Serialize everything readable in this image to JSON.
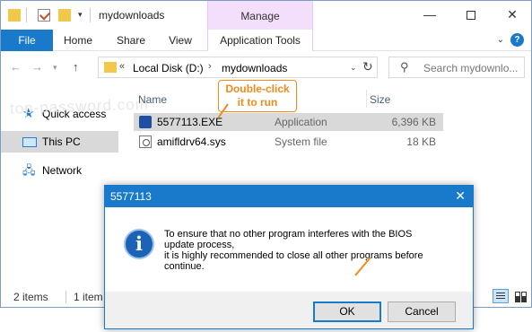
{
  "window": {
    "title": "mydownloads",
    "context_tab": "Manage",
    "controls": {
      "minimize": "—",
      "close": "✕"
    }
  },
  "ribbon": {
    "tabs": [
      "File",
      "Home",
      "Share",
      "View",
      "Application Tools"
    ],
    "help": "?"
  },
  "address": {
    "segments": [
      "Local Disk (D:)",
      "mydownloads"
    ],
    "overflow": "«"
  },
  "search": {
    "placeholder": "Search mydownlo..."
  },
  "nav_pane": {
    "items": [
      {
        "label": "Quick access",
        "icon": "star-icon"
      },
      {
        "label": "This PC",
        "icon": "computer-icon"
      },
      {
        "label": "Network",
        "icon": "network-icon"
      }
    ]
  },
  "file_list": {
    "headers": {
      "name": "Name",
      "size": "Size"
    },
    "rows": [
      {
        "name": "5577113.EXE",
        "type": "Application",
        "size": "6,396 KB",
        "selected": true
      },
      {
        "name": "amifldrv64.sys",
        "type": "System file",
        "size": "18 KB",
        "selected": false
      }
    ]
  },
  "watermark": "top-password.com",
  "callout": {
    "line1": "Double-click",
    "line2": "it to run"
  },
  "status": {
    "items": "2 items",
    "selected": "1 item selected"
  },
  "dialog": {
    "title": "5577113",
    "message_lines": [
      "To ensure that no other program interferes with the BIOS",
      "update process,",
      "it is highly recommended to close all other programs before",
      "continue."
    ],
    "ok_label": "OK",
    "cancel_label": "Cancel"
  },
  "colors": {
    "accent": "#1979ca",
    "manage": "#f3dffb",
    "annotation": "#f08a1c"
  }
}
